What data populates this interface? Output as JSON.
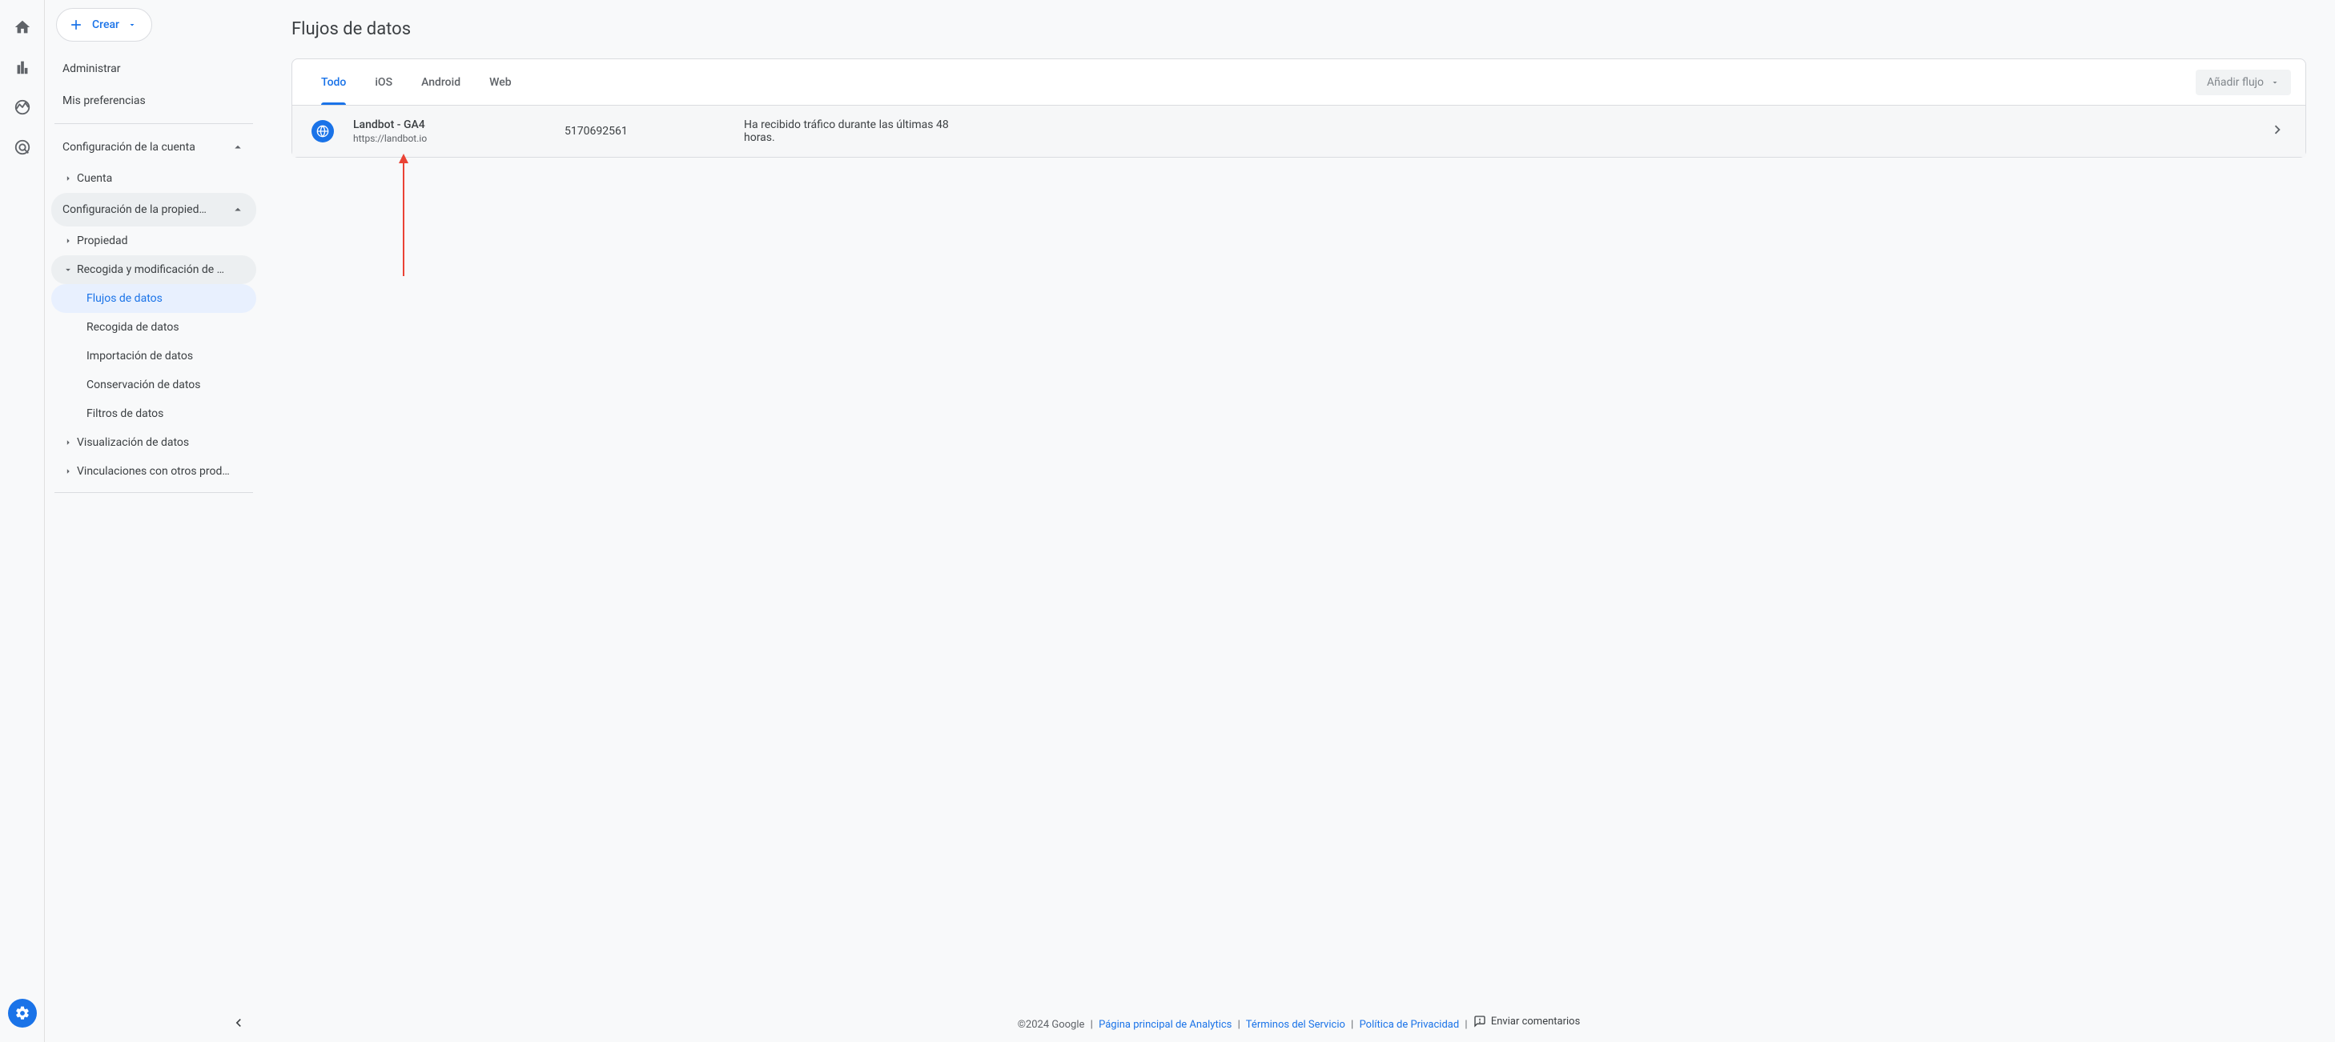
{
  "sidebar": {
    "create_label": "Crear",
    "top_items": [
      {
        "label": "Administrar"
      },
      {
        "label": "Mis preferencias"
      }
    ],
    "account_section": {
      "header": "Configuración de la cuenta",
      "items": [
        {
          "label": "Cuenta"
        }
      ]
    },
    "property_section": {
      "header": "Configuración de la propied…",
      "property_item": "Propiedad",
      "data_collection": {
        "label": "Recogida y modificación de …",
        "children": [
          {
            "label": "Flujos de datos",
            "active": true
          },
          {
            "label": "Recogida de datos"
          },
          {
            "label": "Importación de datos"
          },
          {
            "label": "Conservación de datos"
          },
          {
            "label": "Filtros de datos"
          }
        ]
      },
      "viz_item": "Visualización de datos",
      "linking_item": "Vinculaciones con otros prod…"
    }
  },
  "main": {
    "title": "Flujos de datos",
    "tabs": [
      {
        "label": "Todo",
        "active": true
      },
      {
        "label": "iOS"
      },
      {
        "label": "Android"
      },
      {
        "label": "Web"
      }
    ],
    "add_flow_label": "Añadir flujo",
    "streams": [
      {
        "name": "Landbot - GA4",
        "url": "https://landbot.io",
        "id": "5170692561",
        "status": "Ha recibido tráfico durante las últimas 48 horas."
      }
    ]
  },
  "footer": {
    "copyright": "©2024 Google",
    "links": [
      {
        "label": "Página principal de Analytics"
      },
      {
        "label": "Términos del Servicio"
      },
      {
        "label": "Política de Privacidad"
      }
    ],
    "feedback_label": "Enviar comentarios"
  }
}
